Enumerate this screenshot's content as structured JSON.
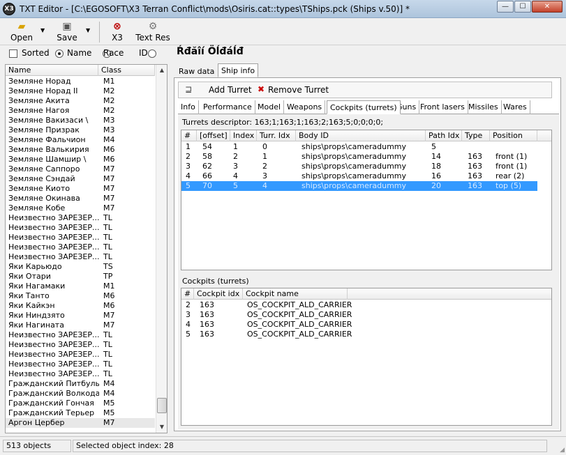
{
  "window": {
    "title": "TXT Editor - [C:\\EGOSOFT\\X3 Terran Conflict\\mods\\Osiris.cat::types\\TShips.pck (Ships v.50)] *",
    "app_icon": "X3",
    "minimize": "—",
    "maximize": "☐",
    "close": "✕"
  },
  "toolbar": {
    "open": "Open",
    "save": "Save",
    "x3": "X3",
    "text_res": "Text Res"
  },
  "sort": {
    "sorted": "Sorted",
    "name": "Name",
    "race": "Race",
    "id": "ID",
    "selected": "Name"
  },
  "ship_list": {
    "headers": [
      "Name",
      "Class"
    ],
    "rows": [
      [
        "Земляне Норад",
        "M1"
      ],
      [
        "Земляне Норад II",
        "M2"
      ],
      [
        "Земляне Акита",
        "M2"
      ],
      [
        "Земляне Нагоя",
        "M2"
      ],
      [
        "Земляне Вакизаси \\",
        "M3"
      ],
      [
        "Земляне Призрак",
        "M3"
      ],
      [
        "Земляне Фальчион",
        "M4"
      ],
      [
        "Земляне Валькирия",
        "M6"
      ],
      [
        "Земляне Шамшир \\",
        "M6"
      ],
      [
        "Земляне Саппоро",
        "M7"
      ],
      [
        "Земляне Сэндай",
        "M7"
      ],
      [
        "Земляне Киото",
        "M7"
      ],
      [
        "Земляне Окинава",
        "M7"
      ],
      [
        "Земляне Кобе",
        "M7"
      ],
      [
        "Неизвестно ЗАРЕЗЕР...",
        "TL"
      ],
      [
        "Неизвестно ЗАРЕЗЕР...",
        "TL"
      ],
      [
        "Неизвестно ЗАРЕЗЕР...",
        "TL"
      ],
      [
        "Неизвестно ЗАРЕЗЕР...",
        "TL"
      ],
      [
        "Неизвестно ЗАРЕЗЕР...",
        "TL"
      ],
      [
        "Яки Карьюдо",
        "TS"
      ],
      [
        "Яки Отари",
        "TP"
      ],
      [
        "Яки Нагамаки",
        "M1"
      ],
      [
        "Яки Танто",
        "M6"
      ],
      [
        "Яки Кайкэн",
        "M6"
      ],
      [
        "Яки Ниндзято",
        "M7"
      ],
      [
        "Яки Нагината",
        "M7"
      ],
      [
        "Неизвестно ЗАРЕЗЕР...",
        "TL"
      ],
      [
        "Неизвестно ЗАРЕЗЕР...",
        "TL"
      ],
      [
        "Неизвестно ЗАРЕЗЕР...",
        "TL"
      ],
      [
        "Неизвестно ЗАРЕЗЕР...",
        "TL"
      ],
      [
        "Неизвестно ЗАРЕЗЕР...",
        "TL"
      ],
      [
        "Гражданский Питбуль",
        "M4"
      ],
      [
        "Гражданский Волкодав",
        "M4"
      ],
      [
        "Гражданский Гончая",
        "M5"
      ],
      [
        "Гражданский Терьер",
        "M5"
      ],
      [
        "Аргон Цербер",
        "M7"
      ]
    ],
    "selected_index": 35
  },
  "ship_title": "Ŕđăîí Öĺđáĺđ",
  "main_tabs": [
    "Raw data",
    "Ship info"
  ],
  "active_main_tab": "Ship info",
  "turret_actions": {
    "add": "Add Turret",
    "remove": "Remove Turret"
  },
  "sub_tabs": [
    "Info",
    "Performance",
    "Model",
    "Weapons",
    "Cockpits (turrets)",
    "Guns",
    "Front lasers",
    "Missiles",
    "Wares"
  ],
  "active_sub_tab": "Cockpits (turrets)",
  "turrets": {
    "descriptor": "Turrets descriptor: 163;1;163;1;163;2;163;5;0;0;0;0;",
    "headers": [
      "#",
      "[offset]",
      "Index",
      "Turr. Idx",
      "Body ID",
      "Path Idx",
      "Type",
      "Position"
    ],
    "rows": [
      [
        "1",
        "54",
        "1",
        "0",
        "ships\\props\\cameradummy",
        "5",
        "",
        ""
      ],
      [
        "2",
        "58",
        "2",
        "1",
        "ships\\props\\cameradummy",
        "14",
        "163",
        "front (1)"
      ],
      [
        "3",
        "62",
        "3",
        "2",
        "ships\\props\\cameradummy",
        "18",
        "163",
        "front (1)"
      ],
      [
        "4",
        "66",
        "4",
        "3",
        "ships\\props\\cameradummy",
        "16",
        "163",
        "rear (2)"
      ],
      [
        "5",
        "70",
        "5",
        "4",
        "ships\\props\\cameradummy",
        "20",
        "163",
        "top (5)"
      ]
    ],
    "selected_row": 4
  },
  "cockpits": {
    "label": "Cockpits (turrets)",
    "headers": [
      "#",
      "Cockpit idx",
      "Cockpit name"
    ],
    "rows": [
      [
        "2",
        "163",
        "OS_COCKPIT_ALD_CARRIER"
      ],
      [
        "3",
        "163",
        "OS_COCKPIT_ALD_CARRIER"
      ],
      [
        "4",
        "163",
        "OS_COCKPIT_ALD_CARRIER"
      ],
      [
        "5",
        "163",
        "OS_COCKPIT_ALD_CARRIER"
      ]
    ]
  },
  "status": {
    "objects": "513 objects",
    "selected": "Selected object index: 28"
  },
  "colors": {
    "selection": "#3399ff",
    "titlebar": "#c7d8ea",
    "close_button": "#c4412a"
  }
}
